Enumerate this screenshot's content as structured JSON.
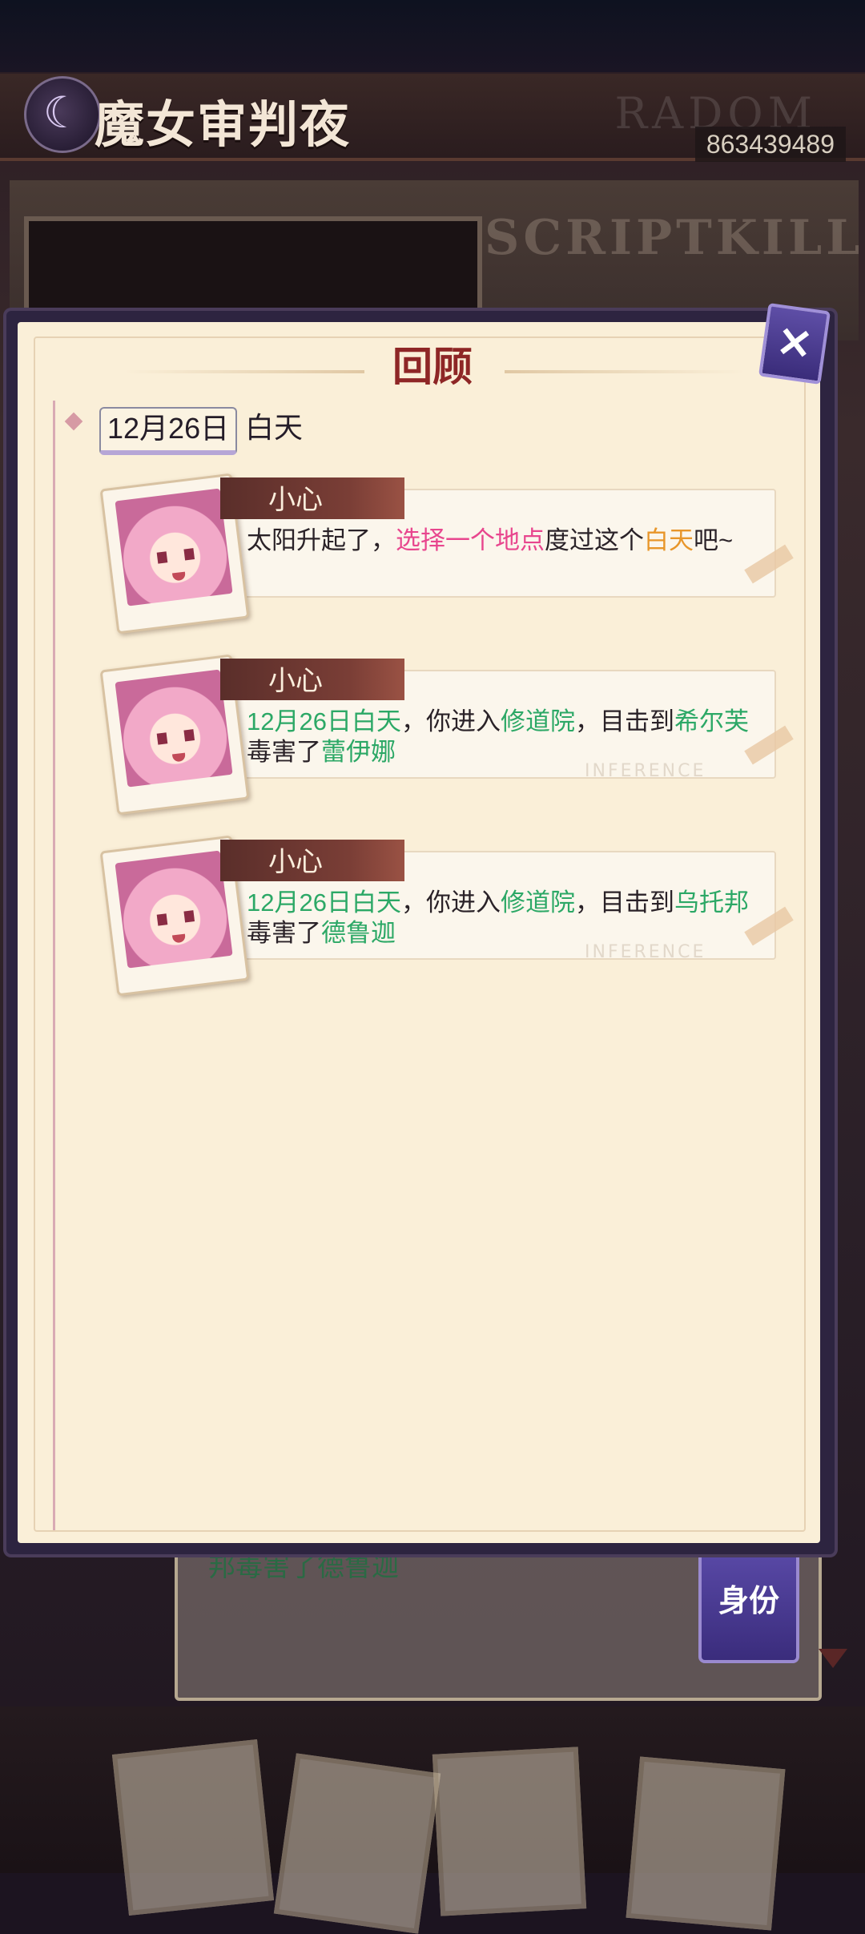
{
  "game": {
    "title": "魔女审判夜",
    "room_id": "863439489",
    "room_ghost": "RADOM",
    "watermark": "SCRIPTKILL",
    "behind_text": "邦毒害了德鲁迦",
    "identity_button": "身份"
  },
  "review": {
    "title": "回顾",
    "date": "12月26日",
    "phase": "白天",
    "messages": [
      {
        "speaker": "小心",
        "segments": [
          {
            "text": "太阳升起了，",
            "style": "normal"
          },
          {
            "text": "选择一个地点",
            "style": "pink"
          },
          {
            "text": "度过这个",
            "style": "normal"
          },
          {
            "text": "白天",
            "style": "orange"
          },
          {
            "text": "吧~",
            "style": "normal"
          }
        ]
      },
      {
        "speaker": "小心",
        "segments": [
          {
            "text": "12月26日白天",
            "style": "green"
          },
          {
            "text": "，你进入",
            "style": "normal"
          },
          {
            "text": "修道院",
            "style": "green"
          },
          {
            "text": "，目击到",
            "style": "normal"
          },
          {
            "text": "希尔芙",
            "style": "green"
          },
          {
            "text": "毒害了",
            "style": "normal"
          },
          {
            "text": "蕾伊娜",
            "style": "green"
          }
        ]
      },
      {
        "speaker": "小心",
        "segments": [
          {
            "text": "12月26日白天",
            "style": "green"
          },
          {
            "text": "，你进入",
            "style": "normal"
          },
          {
            "text": "修道院",
            "style": "green"
          },
          {
            "text": "，目击到",
            "style": "normal"
          },
          {
            "text": "乌托邦",
            "style": "green"
          },
          {
            "text": "毒害了",
            "style": "normal"
          },
          {
            "text": "德鲁迦",
            "style": "green"
          }
        ]
      }
    ],
    "bubble_ghost": "INFERENCE",
    "colors": {
      "pink": "#e8468e",
      "orange": "#e8962a",
      "green": "#2ca866",
      "title": "#8e2626"
    },
    "close_icon": "close-icon"
  }
}
